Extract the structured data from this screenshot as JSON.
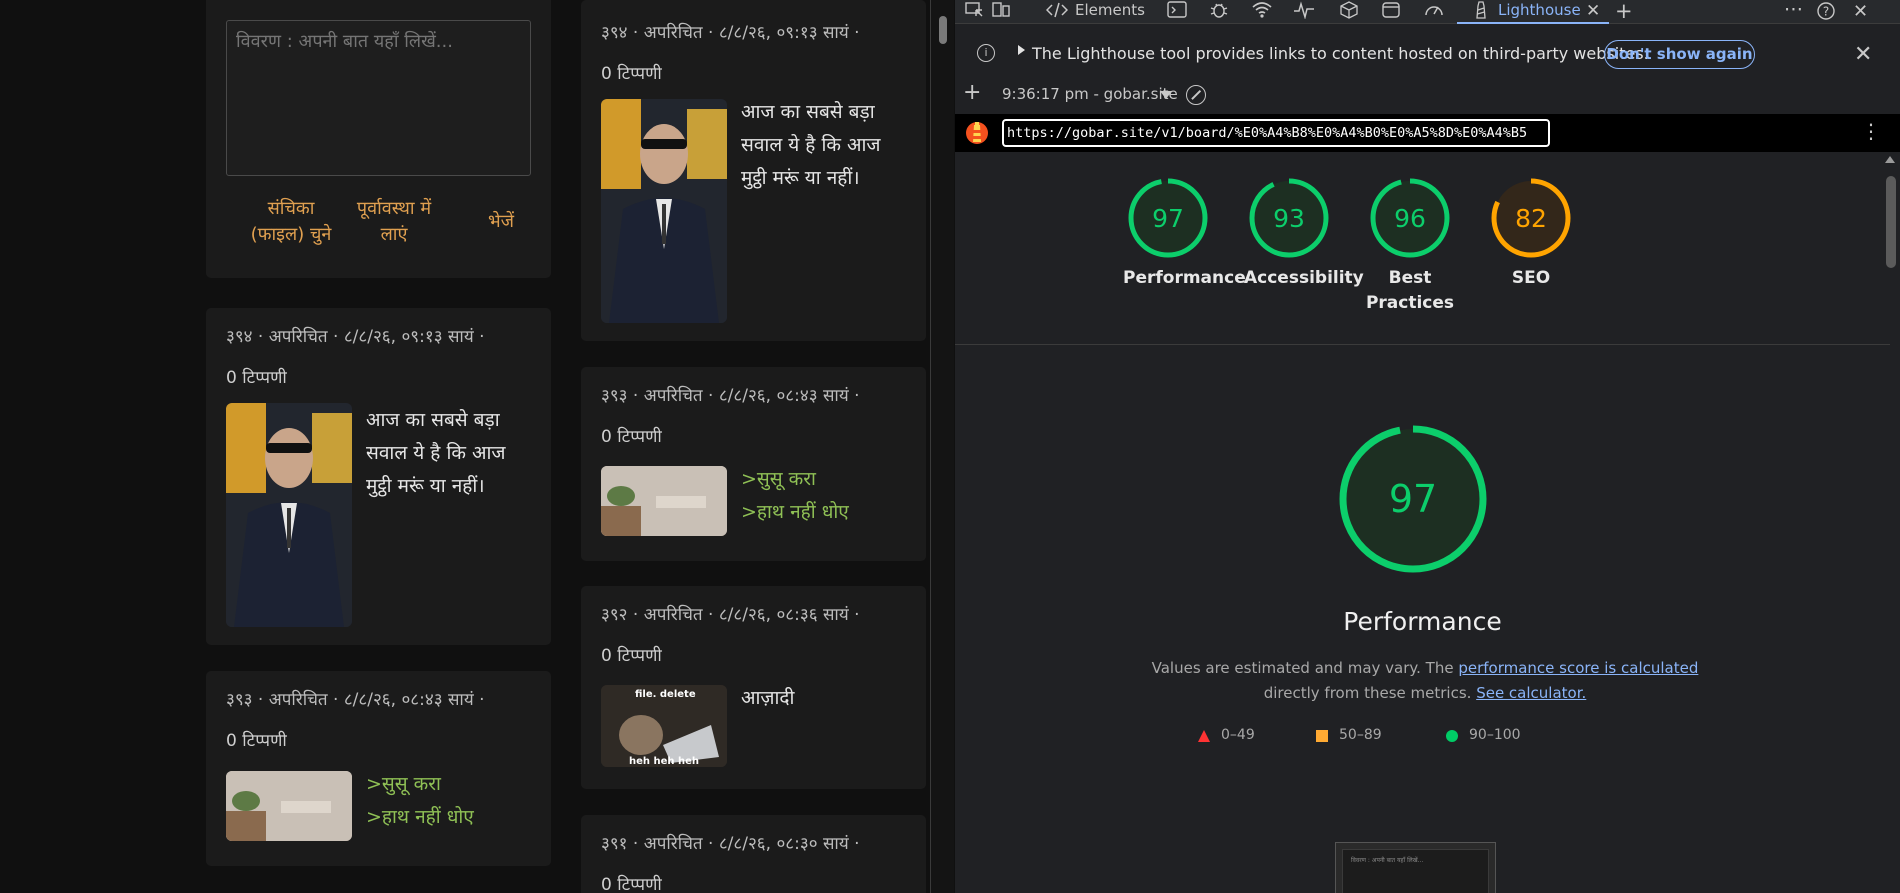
{
  "forum": {
    "form": {
      "placeholder": "विवरण : अपनी बात यहाँ लिखें...",
      "file_button_line1": "संचिका",
      "file_button_line2": "(फाइल) चुने",
      "reset_button_line1": "पूर्वावस्था में",
      "reset_button_line2": "लाएं",
      "send_button": "भेजें"
    },
    "col1_posts": [
      {
        "meta": "३९४ · अपरिचित · ८/८/२६, ०९:१३ सायं ·",
        "comments": "0 टिप्पणी",
        "text": "आज का सबसे बड़ा सवाल ये है कि आज मुट्ठी मरूं या नहीं।"
      },
      {
        "meta": "३९३ · अपरिचित · ८/८/२६, ०८:४३ सायं ·",
        "comments": "0 टिप्पणी",
        "line1": ">सुसू करा",
        "line2": ">हाथ नहीं धोए"
      }
    ],
    "col2_posts": [
      {
        "meta": "३९४ · अपरिचित · ८/८/२६, ०९:१३ सायं ·",
        "comments": "0 टिप्पणी",
        "text": "आज का सबसे बड़ा सवाल ये है कि आज मुट्ठी मरूं या नहीं।"
      },
      {
        "meta": "३९३ · अपरिचित · ८/८/२६, ०८:४३ सायं ·",
        "comments": "0 टिप्पणी",
        "line1": ">सुसू करा",
        "line2": ">हाथ नहीं धोए"
      },
      {
        "meta": "३९२ · अपरिचित · ८/८/२६, ०८:३६ सायं ·",
        "comments": "0 टिप्पणी",
        "text": "आज़ादी",
        "meme_top": "file. delete",
        "meme_bottom": "heh heh heh"
      },
      {
        "meta": "३९१ · अपरिचित · ८/८/२६, ०८:३० सायं ·",
        "comments": "0 टिप्पणी"
      }
    ]
  },
  "devtools": {
    "tabs": {
      "elements": "Elements",
      "lighthouse": "Lighthouse"
    },
    "icons": [
      "inspect-icon",
      "device-icon",
      "console-icon",
      "bug-icon",
      "wifi-icon",
      "performance-icon",
      "memory-icon",
      "application-icon",
      "gauge-icon",
      "lighthouse-icon"
    ],
    "infobar": {
      "text": "The Lighthouse tool provides links to content hosted on third-party websites.",
      "dont_show": "Don't show again"
    },
    "run": {
      "label": "9:36:17 pm - gobar.site"
    },
    "url": "https://gobar.site/v1/board/%E0%A4%B8%E0%A4%B0%E0%A5%8D%E0%A4%B5",
    "scores": [
      {
        "label": "Performance",
        "value": 97,
        "color": "#0cce6b"
      },
      {
        "label": "Accessibility",
        "value": 93,
        "color": "#0cce6b"
      },
      {
        "label": "Best Practices",
        "label_line1": "Best",
        "label_line2": "Practices",
        "value": 96,
        "color": "#0cce6b"
      },
      {
        "label": "SEO",
        "value": 82,
        "color": "#ffa400"
      }
    ],
    "performance": {
      "score": 97,
      "title": "Performance",
      "desc_prefix": "Values are estimated and may vary. The ",
      "desc_link": "performance score is calculated",
      "desc_middle": "directly from these metrics. ",
      "desc_link2": "See calculator.",
      "legend": [
        "0–49",
        "50–89",
        "90–100"
      ],
      "screenshot_text": "विवरण : अपनी बात यहाँ लिखें..."
    }
  }
}
